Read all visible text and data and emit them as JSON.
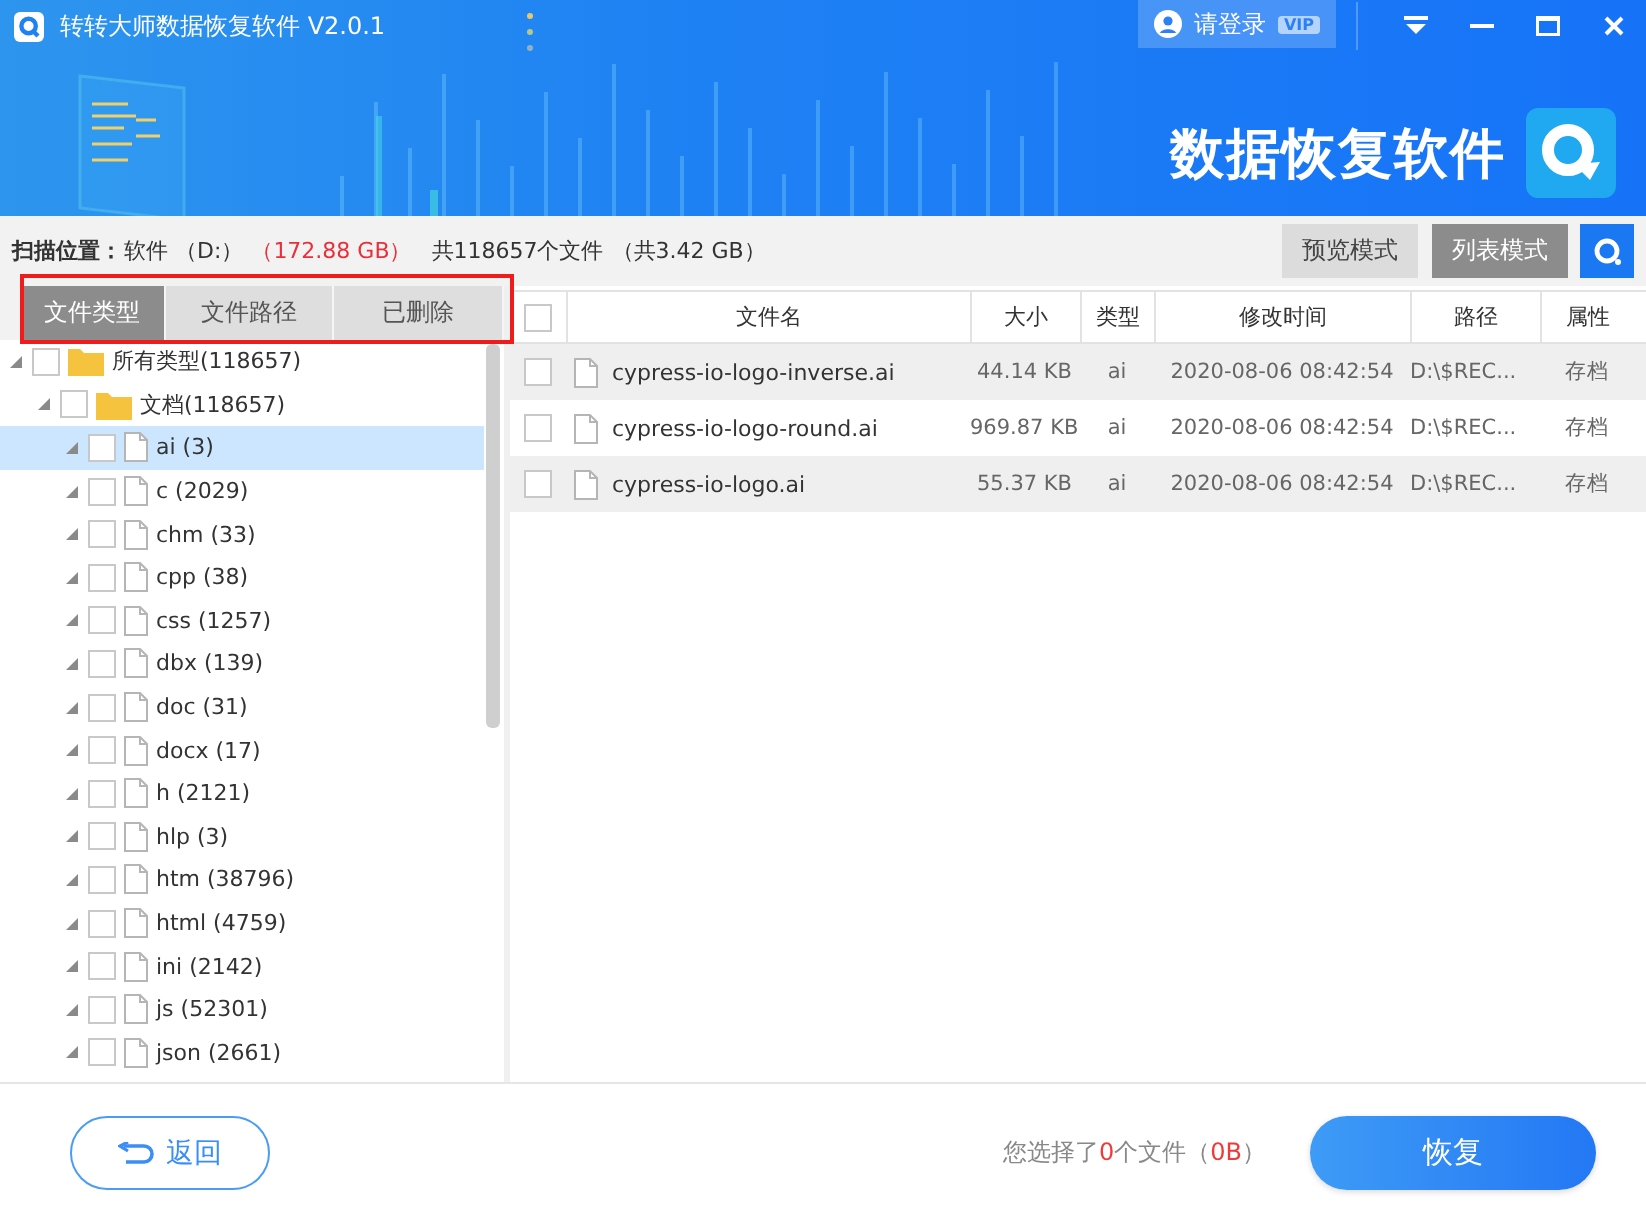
{
  "window": {
    "title": "转转大师数据恢复软件 V2.0.1"
  },
  "account": {
    "login": "请登录",
    "badge": "VIP"
  },
  "brand": {
    "text": "数据恢复软件"
  },
  "scan_info": {
    "label": "扫描位置：",
    "drive": "软件 （D:）",
    "capacity": "（172.88 GB）",
    "file_count": "共118657个文件",
    "total_size": "（共3.42 GB）"
  },
  "view_modes": [
    {
      "label": "预览模式",
      "selected": false
    },
    {
      "label": "列表模式",
      "selected": true
    }
  ],
  "tabs": [
    {
      "label": "文件类型",
      "selected": true
    },
    {
      "label": "文件路径",
      "selected": false
    },
    {
      "label": "已删除",
      "selected": false
    }
  ],
  "tree": [
    {
      "label": "所有类型(118657)",
      "kind": "folder",
      "checked": false,
      "selected": false,
      "children": [
        {
          "label": "文档(118657)",
          "kind": "folder",
          "checked": false,
          "selected": false,
          "children": [
            {
              "label": "ai (3)",
              "kind": "file",
              "checked": false,
              "selected": true
            },
            {
              "label": "c (2029)",
              "kind": "file",
              "checked": false,
              "selected": false
            },
            {
              "label": "chm (33)",
              "kind": "file",
              "checked": false,
              "selected": false
            },
            {
              "label": "cpp (38)",
              "kind": "file",
              "checked": false,
              "selected": false
            },
            {
              "label": "css (1257)",
              "kind": "file",
              "checked": false,
              "selected": false
            },
            {
              "label": "dbx (139)",
              "kind": "file",
              "checked": false,
              "selected": false
            },
            {
              "label": "doc (31)",
              "kind": "file",
              "checked": false,
              "selected": false
            },
            {
              "label": "docx (17)",
              "kind": "file",
              "checked": false,
              "selected": false
            },
            {
              "label": "h (2121)",
              "kind": "file",
              "checked": false,
              "selected": false
            },
            {
              "label": "hlp (3)",
              "kind": "file",
              "checked": false,
              "selected": false
            },
            {
              "label": "htm (38796)",
              "kind": "file",
              "checked": false,
              "selected": false
            },
            {
              "label": "html (4759)",
              "kind": "file",
              "checked": false,
              "selected": false
            },
            {
              "label": "ini (2142)",
              "kind": "file",
              "checked": false,
              "selected": false
            },
            {
              "label": "js (52301)",
              "kind": "file",
              "checked": false,
              "selected": false
            },
            {
              "label": "json (2661)",
              "kind": "file",
              "checked": false,
              "selected": false
            }
          ]
        }
      ]
    }
  ],
  "table": {
    "all_checked": false,
    "columns": [
      "文件名",
      "大小",
      "类型",
      "修改时间",
      "路径",
      "属性"
    ],
    "rows": [
      {
        "checked": false,
        "cells": [
          "cypress-io-logo-inverse.ai",
          "44.14 KB",
          "ai",
          "2020-08-06 08:42:54",
          "D:\\$REC...",
          "存档"
        ]
      },
      {
        "checked": false,
        "cells": [
          "cypress-io-logo-round.ai",
          "969.87 KB",
          "ai",
          "2020-08-06 08:42:54",
          "D:\\$REC...",
          "存档"
        ]
      },
      {
        "checked": false,
        "cells": [
          "cypress-io-logo.ai",
          "55.37 KB",
          "ai",
          "2020-08-06 08:42:54",
          "D:\\$REC...",
          "存档"
        ]
      }
    ]
  },
  "footer": {
    "back": "返回",
    "selection": [
      {
        "text": "您选择了",
        "highlight": false
      },
      {
        "text": "0",
        "highlight": true
      },
      {
        "text": "个文件（",
        "highlight": false
      },
      {
        "text": "0B",
        "highlight": true
      },
      {
        "text": "）",
        "highlight": false
      }
    ],
    "recover": "恢复"
  }
}
